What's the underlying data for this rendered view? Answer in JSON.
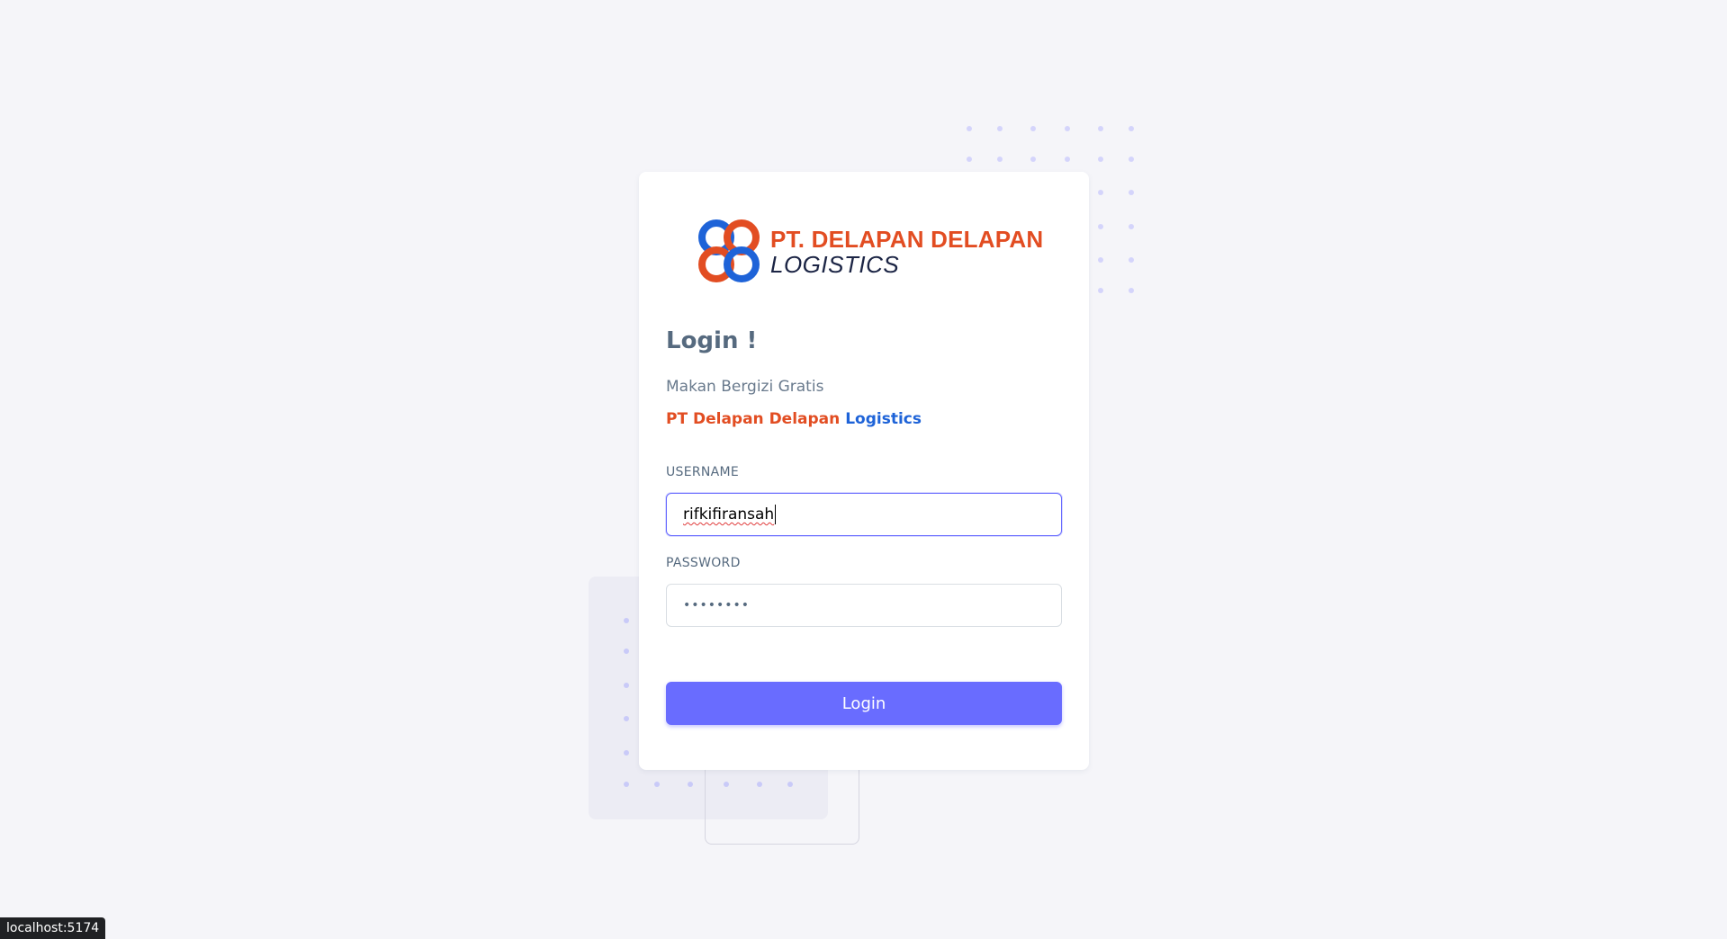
{
  "brand": {
    "line1": "PT. DELAPAN DELAPAN",
    "line2": "LOGISTICS",
    "color_primary": "#e24d22",
    "color_secondary": "#1e63d8"
  },
  "login": {
    "title": "Login !",
    "subtitle": "Makan Bergizi Gratis",
    "company_part1": "PT Delapan Delapan",
    "company_part2": "Logistics"
  },
  "form": {
    "username_label": "USERNAME",
    "username_value": "rifkifiransah",
    "password_label": "PASSWORD",
    "password_value": "••••••••",
    "submit_label": "Login"
  },
  "status_bar": {
    "url": "localhost:5174"
  },
  "theme": {
    "accent": "#696cff",
    "background": "#f5f5f9"
  }
}
